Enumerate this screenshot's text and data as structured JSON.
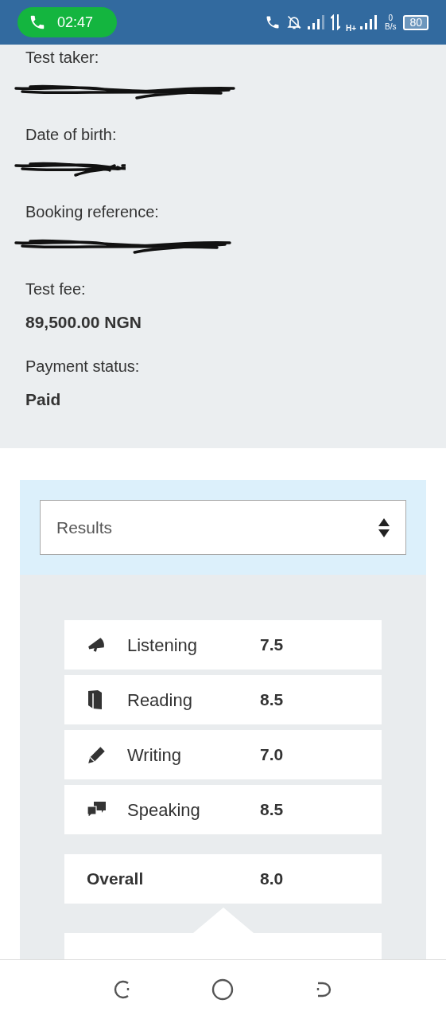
{
  "status_bar": {
    "call_time": "02:47",
    "network_type": "H+",
    "speed_value": "0",
    "speed_unit": "B/s",
    "battery": "80"
  },
  "details": [
    {
      "label": "Test taker:",
      "kind": "redacted"
    },
    {
      "label": "Date of birth:",
      "kind": "redacted"
    },
    {
      "label": "Booking reference:",
      "kind": "redacted"
    },
    {
      "label": "Test fee:",
      "kind": "text",
      "value": "89,500.00 NGN"
    },
    {
      "label": "Payment status:",
      "kind": "text",
      "value": "Paid"
    }
  ],
  "results": {
    "select_value": "Results",
    "scores": [
      {
        "kind": "listening",
        "label": "Listening",
        "score": "7.5"
      },
      {
        "kind": "reading",
        "label": "Reading",
        "score": "8.5"
      },
      {
        "kind": "writing",
        "label": "Writing",
        "score": "7.0"
      },
      {
        "kind": "speaking",
        "label": "Speaking",
        "score": "8.5"
      }
    ],
    "overall": {
      "label": "Overall",
      "score": "8.0"
    }
  }
}
